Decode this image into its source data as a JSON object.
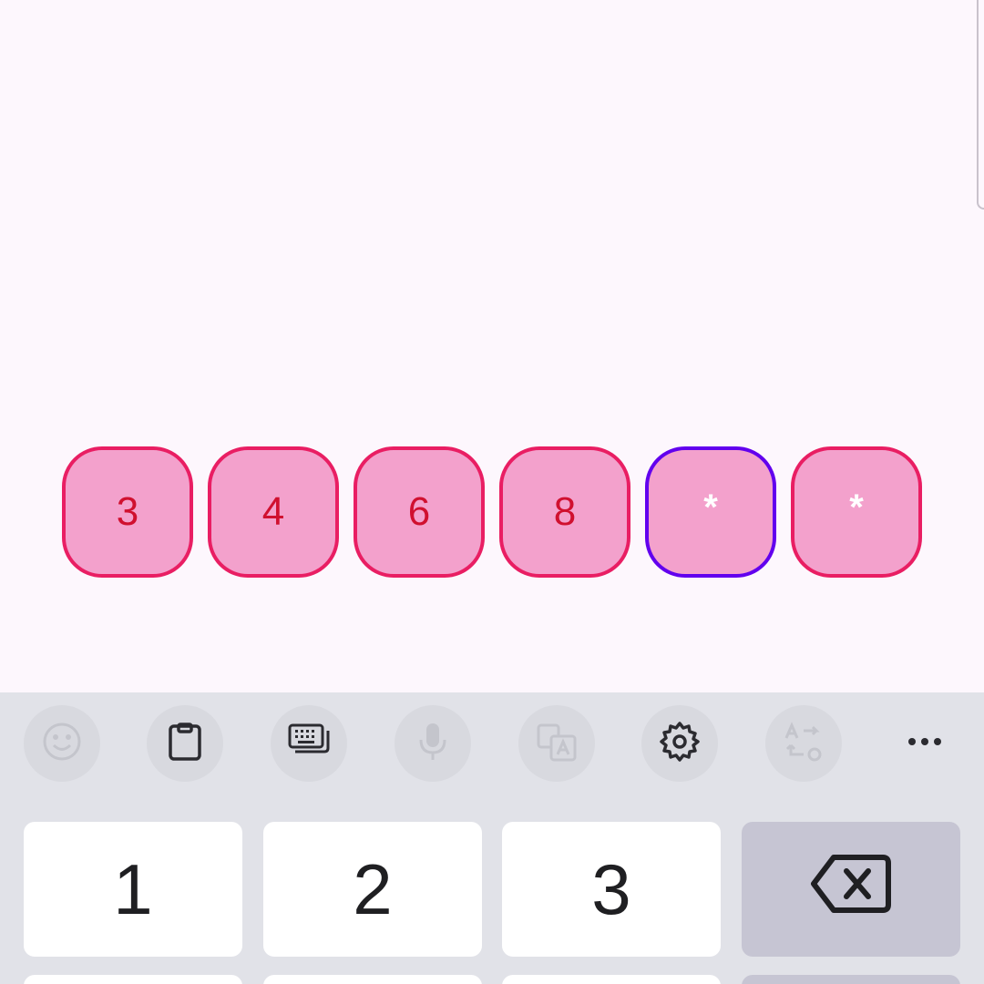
{
  "otp": {
    "digits": [
      "3",
      "4",
      "6",
      "8",
      "*",
      "*"
    ]
  },
  "keyboard": {
    "toolbar": [
      "emoji-icon",
      "clipboard-icon",
      "keyboard-icon",
      "microphone-icon",
      "translate-icon",
      "settings-icon",
      "text-swap-icon",
      "more-icon"
    ],
    "keys": {
      "one": "1",
      "two": "2",
      "three": "3",
      "backspace": "backspace-icon"
    }
  },
  "colors": {
    "box_border": "#e91e63",
    "box_focus_border": "#6200ee",
    "box_fill": "#f3a1cc",
    "digit": "#d0102f",
    "keyboard_bg": "#e1e2e8"
  }
}
